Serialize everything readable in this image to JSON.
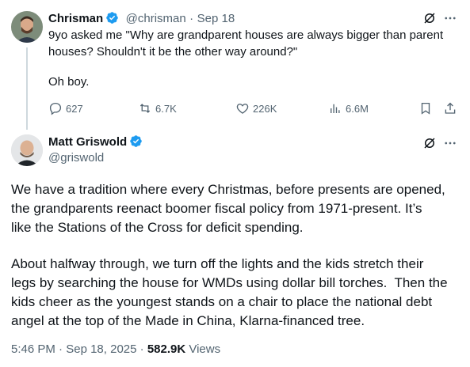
{
  "tweet1": {
    "author_name": "Chrisman",
    "handle": "@chrisman",
    "separator": "·",
    "date": "Sep 18",
    "text_line1": "9yo asked me \"Why are grandparent houses are always bigger than parent",
    "text_line2": "houses? Shouldn't it be the other way around?\"",
    "text_line3": "Oh boy.",
    "stats": {
      "replies": "627",
      "reposts": "6.7K",
      "likes": "226K",
      "views": "6.6M"
    }
  },
  "tweet2": {
    "author_name": "Matt Griswold",
    "handle": "@griswold",
    "paragraph1": "We have a tradition where every Christmas, before presents are opened,\nthe grandparents reenact boomer fiscal policy from 1971-present. It’s\nlike the Stations of the Cross for deficit spending.",
    "paragraph2": "About halfway through, we turn off the lights and the kids stretch their\nlegs by searching the house for WMDs using dollar bill torches.  Then the\nkids cheer as the youngest stands on a chair to place the national debt\nangel at the top of the Made in China, Klarna-financed tree.",
    "time": "5:46 PM",
    "date": "Sep 18, 2025",
    "separator": "·",
    "views_count": "582.9K",
    "views_label": "Views"
  },
  "colors": {
    "verified": "#1d9bf0",
    "text": "#0f1419",
    "secondary": "#536471",
    "thread_line": "#cfd9de"
  }
}
